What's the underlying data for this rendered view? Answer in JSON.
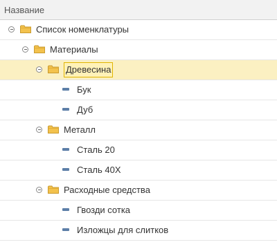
{
  "header": {
    "title": "Название"
  },
  "tree": [
    {
      "label": "Список номенклатуры",
      "type": "folder",
      "level": 0
    },
    {
      "label": "Материалы",
      "type": "folder",
      "level": 1
    },
    {
      "label": "Древесина",
      "type": "folder",
      "level": 2,
      "selected": true
    },
    {
      "label": "Бук",
      "type": "item",
      "level": 3
    },
    {
      "label": "Дуб",
      "type": "item",
      "level": 3
    },
    {
      "label": "Металл",
      "type": "folder",
      "level": 2
    },
    {
      "label": "Сталь 20",
      "type": "item",
      "level": 3
    },
    {
      "label": "Сталь 40Х",
      "type": "item",
      "level": 3
    },
    {
      "label": "Расходные средства",
      "type": "folder",
      "level": 2
    },
    {
      "label": "Гвозди сотка",
      "type": "item",
      "level": 3
    },
    {
      "label": "Изложцы для слитков",
      "type": "item",
      "level": 3
    }
  ],
  "icons": {
    "folder": "folder-icon",
    "item": "item-icon",
    "toggle": "collapse-icon"
  },
  "colors": {
    "selected_row": "#fbf0c2",
    "selected_box_border": "#e0b400",
    "folder": "#f3c24d",
    "item": "#5d7fa8"
  }
}
